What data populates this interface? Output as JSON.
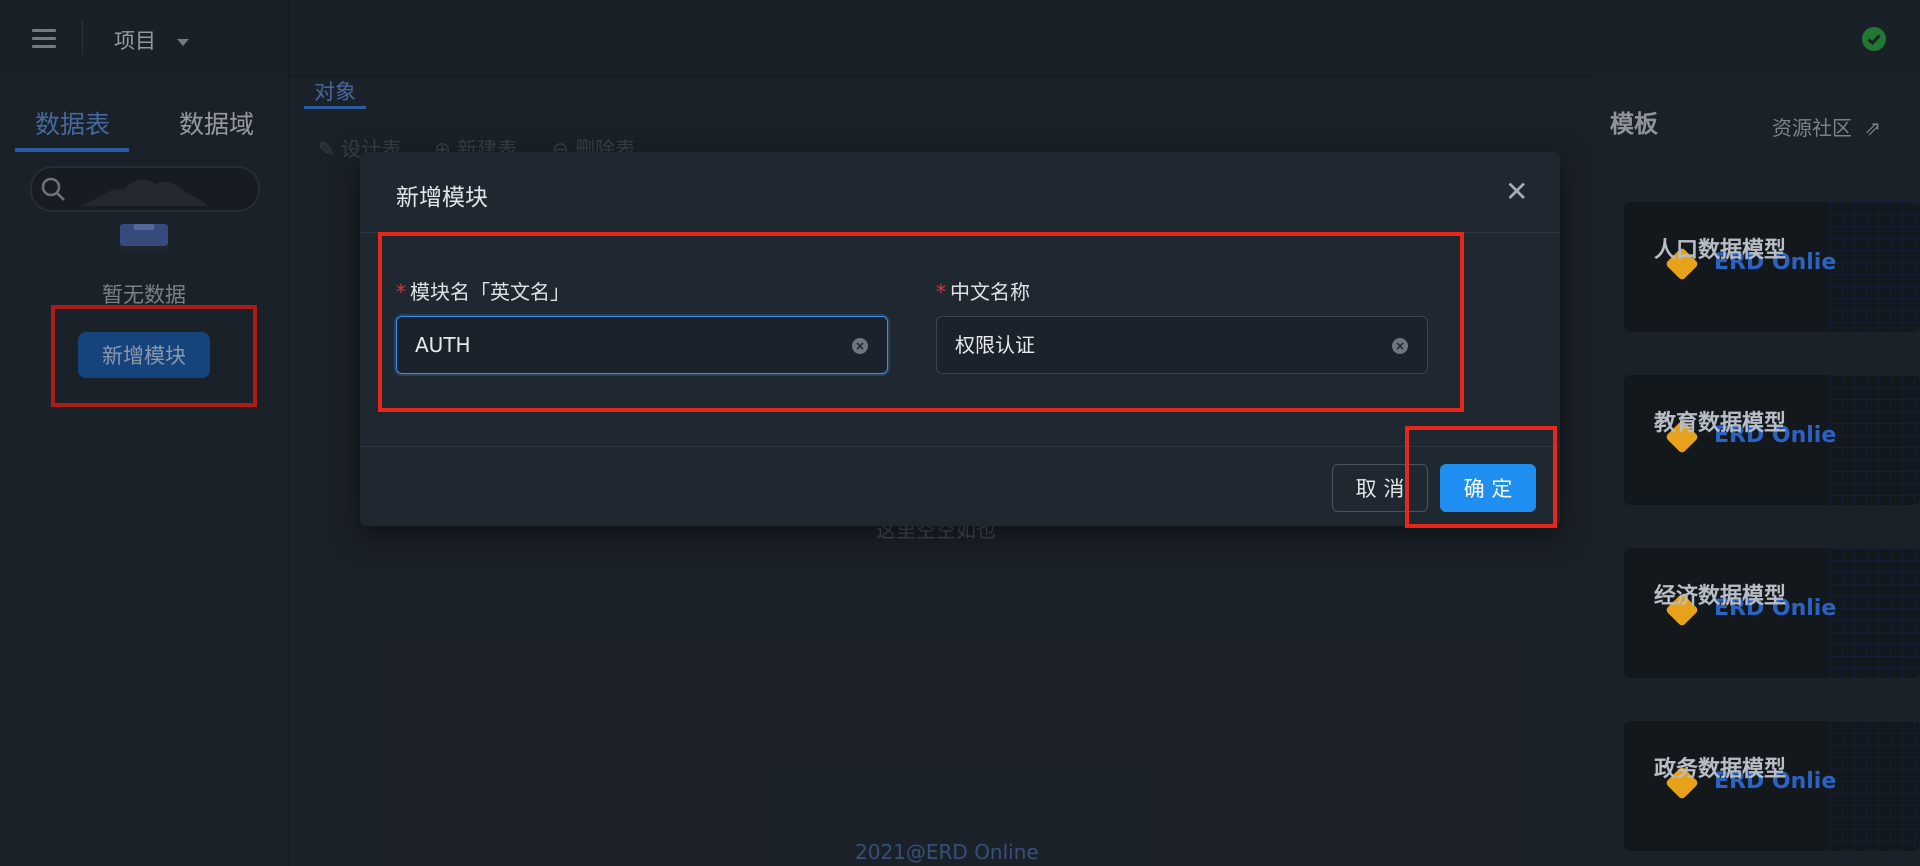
{
  "header": {
    "menu_icon": "hamburger-icon",
    "project_label": "项目",
    "status_icon": "check-circle-icon",
    "status_color": "#2ea043"
  },
  "sidebar": {
    "tabs": [
      {
        "label": "数据表",
        "active": true
      },
      {
        "label": "数据域",
        "active": false
      }
    ],
    "search_icon": "search-icon",
    "empty_text": "暂无数据",
    "new_module_label": "新增模块"
  },
  "main": {
    "tab_label": "对象",
    "toolbar": [
      {
        "icon": "pencil-icon",
        "label": "设计表"
      },
      {
        "icon": "plus-circle-icon",
        "label": "新建表"
      },
      {
        "icon": "minus-circle-icon",
        "label": "删除表"
      }
    ],
    "empty_hint": "这里空空如也",
    "footer": "2021@ERD Online"
  },
  "right_panel": {
    "title": "模板",
    "community_link": "资源社区",
    "templates": [
      {
        "name": "人口数据模型",
        "brand": "ERD Onlie"
      },
      {
        "name": "教育数据模型",
        "brand": "ERD Onlie"
      },
      {
        "name": "经济数据模型",
        "brand": "ERD Onlie"
      },
      {
        "name": "政务数据模型",
        "brand": "ERD Onlie"
      }
    ]
  },
  "modal": {
    "title": "新增模块",
    "fields": [
      {
        "label": "模块名「英文名」",
        "required": true,
        "value": "AUTH"
      },
      {
        "label": "中文名称",
        "required": true,
        "value": "权限认证"
      }
    ],
    "cancel_label": "取 消",
    "ok_label": "确 定"
  },
  "colors": {
    "accent": "#1f8ef1",
    "highlight": "#e8271c",
    "background": "#252d36"
  }
}
